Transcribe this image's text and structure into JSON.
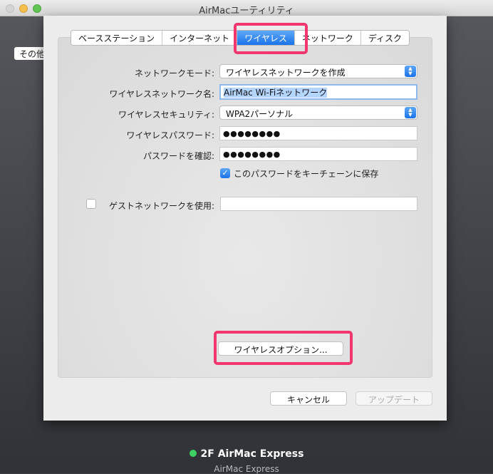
{
  "window": {
    "title": "AirMacユーティリティ"
  },
  "backdrop": {
    "other_button": "その他",
    "device_name": "2F AirMac Express",
    "device_model": "AirMac Express"
  },
  "tabs": [
    {
      "label": "ベースステーション"
    },
    {
      "label": "インターネット"
    },
    {
      "label": "ワイヤレス",
      "active": true
    },
    {
      "label": "ネットワーク"
    },
    {
      "label": "ディスク"
    }
  ],
  "form": {
    "network_mode_label": "ネットワークモード:",
    "network_mode_value": "ワイヤレスネットワークを作成",
    "network_name_label": "ワイヤレスネットワーク名:",
    "network_name_value": "AirMac Wi-Fiネットワーク",
    "security_label": "ワイヤレスセキュリティ:",
    "security_value": "WPA2パーソナル",
    "password_label": "ワイヤレスパスワード:",
    "password_value": "●●●●●●●●",
    "confirm_label": "パスワードを確認:",
    "confirm_value": "●●●●●●●●",
    "keychain_label": "このパスワードをキーチェーンに保存",
    "keychain_checked": true,
    "guest_label": "ゲストネットワークを使用:",
    "guest_checked": false,
    "guest_value": ""
  },
  "buttons": {
    "wireless_options": "ワイヤレスオプション...",
    "cancel": "キャンセル",
    "update": "アップデート"
  },
  "colors": {
    "accent": "#1b73ea",
    "highlight": "#f2366e",
    "status_dot": "#3ed060"
  }
}
